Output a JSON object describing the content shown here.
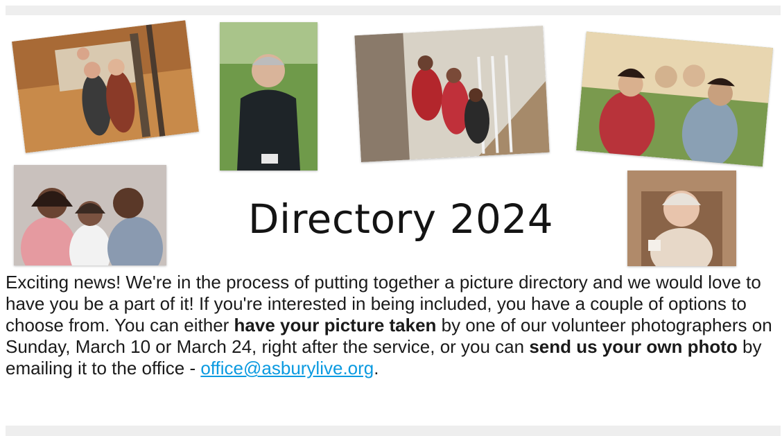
{
  "banner": {
    "headline": "Directory 2024",
    "photos": [
      {
        "name": "family-autumn-photo",
        "palette": [
          "#a86a36",
          "#d9a56a",
          "#5b4a3a"
        ]
      },
      {
        "name": "pastor-portrait-photo",
        "palette": [
          "#6f9a4a",
          "#1e2428",
          "#d9c7b2"
        ]
      },
      {
        "name": "family-staircase-photo",
        "palette": [
          "#d8d2c6",
          "#b3262c",
          "#2a2a2a"
        ]
      },
      {
        "name": "family-outdoors-photo",
        "palette": [
          "#7a9a4e",
          "#b8333a",
          "#d3b28e"
        ]
      },
      {
        "name": "family-selfie-photo",
        "palette": [
          "#c9c1bd",
          "#3a2a22",
          "#e59aa0"
        ]
      },
      {
        "name": "elderly-woman-photo",
        "palette": [
          "#b08a6a",
          "#e7d8c8",
          "#8a6448"
        ]
      }
    ]
  },
  "body": {
    "intro": "Exciting news! We're in the process of putting together a picture directory and we would love to have you be a part of it! If you're interested in being included, you have a couple of options to choose from. You can either ",
    "bold1": "have your picture taken",
    "mid1": " by one of our volunteer photographers on Sunday, March 10 or March 24, right after the service, or you can ",
    "bold2": "send us your own photo",
    "mid2": " by emailing it to the office - ",
    "email": "office@asburylive.org",
    "end": "."
  },
  "colors": {
    "link": "#0b9ae0",
    "divider": "#eeeeee",
    "text": "#1a1a1a"
  }
}
